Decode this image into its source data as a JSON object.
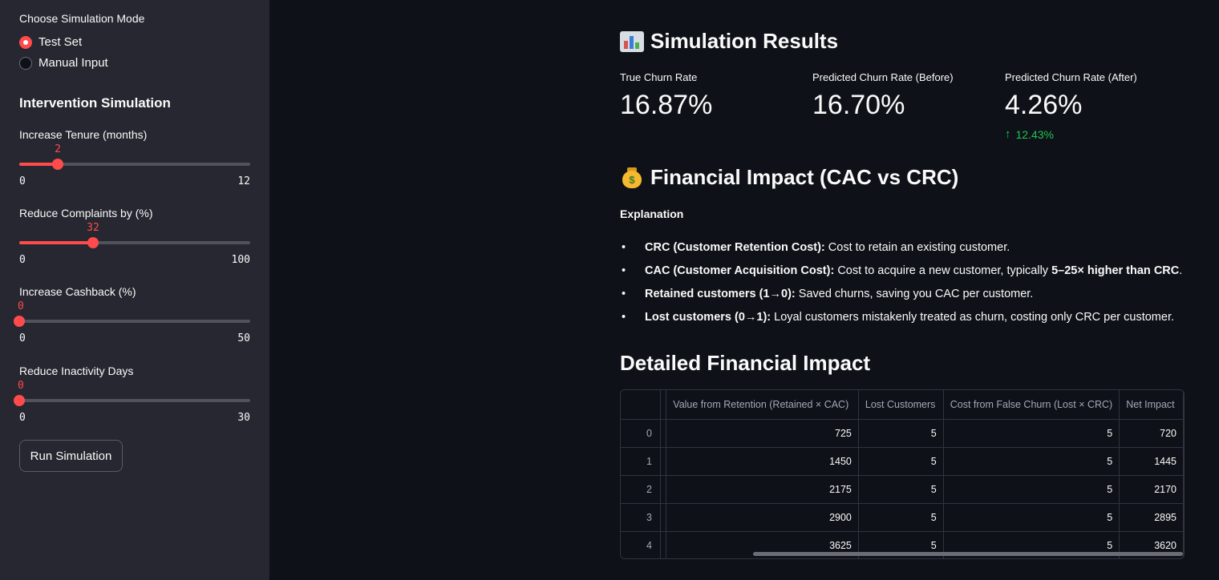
{
  "sidebar": {
    "mode_label": "Choose Simulation Mode",
    "modes": [
      {
        "label": "Test Set",
        "selected": true
      },
      {
        "label": "Manual Input",
        "selected": false
      }
    ],
    "section_heading": "Intervention Simulation",
    "sliders": [
      {
        "label": "Increase Tenure (months)",
        "value": "2",
        "min": "0",
        "max": "12"
      },
      {
        "label": "Reduce Complaints by (%)",
        "value": "32",
        "min": "0",
        "max": "100"
      },
      {
        "label": "Increase Cashback (%)",
        "value": "0",
        "min": "0",
        "max": "50"
      },
      {
        "label": "Reduce Inactivity Days",
        "value": "0",
        "min": "0",
        "max": "30"
      }
    ],
    "run_button": "Run Simulation"
  },
  "main": {
    "results_title": "Simulation Results",
    "metrics": [
      {
        "label": "True Churn Rate",
        "value": "16.87%"
      },
      {
        "label": "Predicted Churn Rate (Before)",
        "value": "16.70%"
      },
      {
        "label": "Predicted Churn Rate (After)",
        "value": "4.26%",
        "delta": "12.43%"
      }
    ],
    "financial_title": "Financial Impact (CAC vs CRC)",
    "explanation_label": "Explanation",
    "bullets": [
      {
        "bold": "CRC (Customer Retention Cost):",
        "text": " Cost to retain an existing customer.",
        "bold2": "",
        "tail": ""
      },
      {
        "bold": "CAC (Customer Acquisition Cost):",
        "text": " Cost to acquire a new customer, typically ",
        "bold2": "5–25× higher than CRC",
        "tail": "."
      },
      {
        "bold": "Retained customers (1→0):",
        "text": " Saved churns, saving you CAC per customer.",
        "bold2": "",
        "tail": ""
      },
      {
        "bold": "Lost customers (0→1):",
        "text": " Loyal customers mistakenly treated as churn, costing only CRC per customer.",
        "bold2": "",
        "tail": ""
      }
    ],
    "detailed_title": "Detailed Financial Impact",
    "table": {
      "columns": [
        "",
        "",
        "Value from Retention (Retained × CAC)",
        "Lost Customers",
        "Cost from False Churn (Lost × CRC)",
        "Net Impact"
      ],
      "rows": [
        [
          "0",
          "",
          "725",
          "5",
          "5",
          "720"
        ],
        [
          "1",
          "",
          "1450",
          "5",
          "5",
          "1445"
        ],
        [
          "2",
          "",
          "2175",
          "5",
          "5",
          "2170"
        ],
        [
          "3",
          "",
          "2900",
          "5",
          "5",
          "2895"
        ],
        [
          "4",
          "",
          "3625",
          "5",
          "5",
          "3620"
        ]
      ]
    }
  },
  "colors": {
    "accent": "#ff4b4b",
    "positive": "#21c354",
    "sidebar_bg": "#262730",
    "main_bg": "#0e1117"
  }
}
